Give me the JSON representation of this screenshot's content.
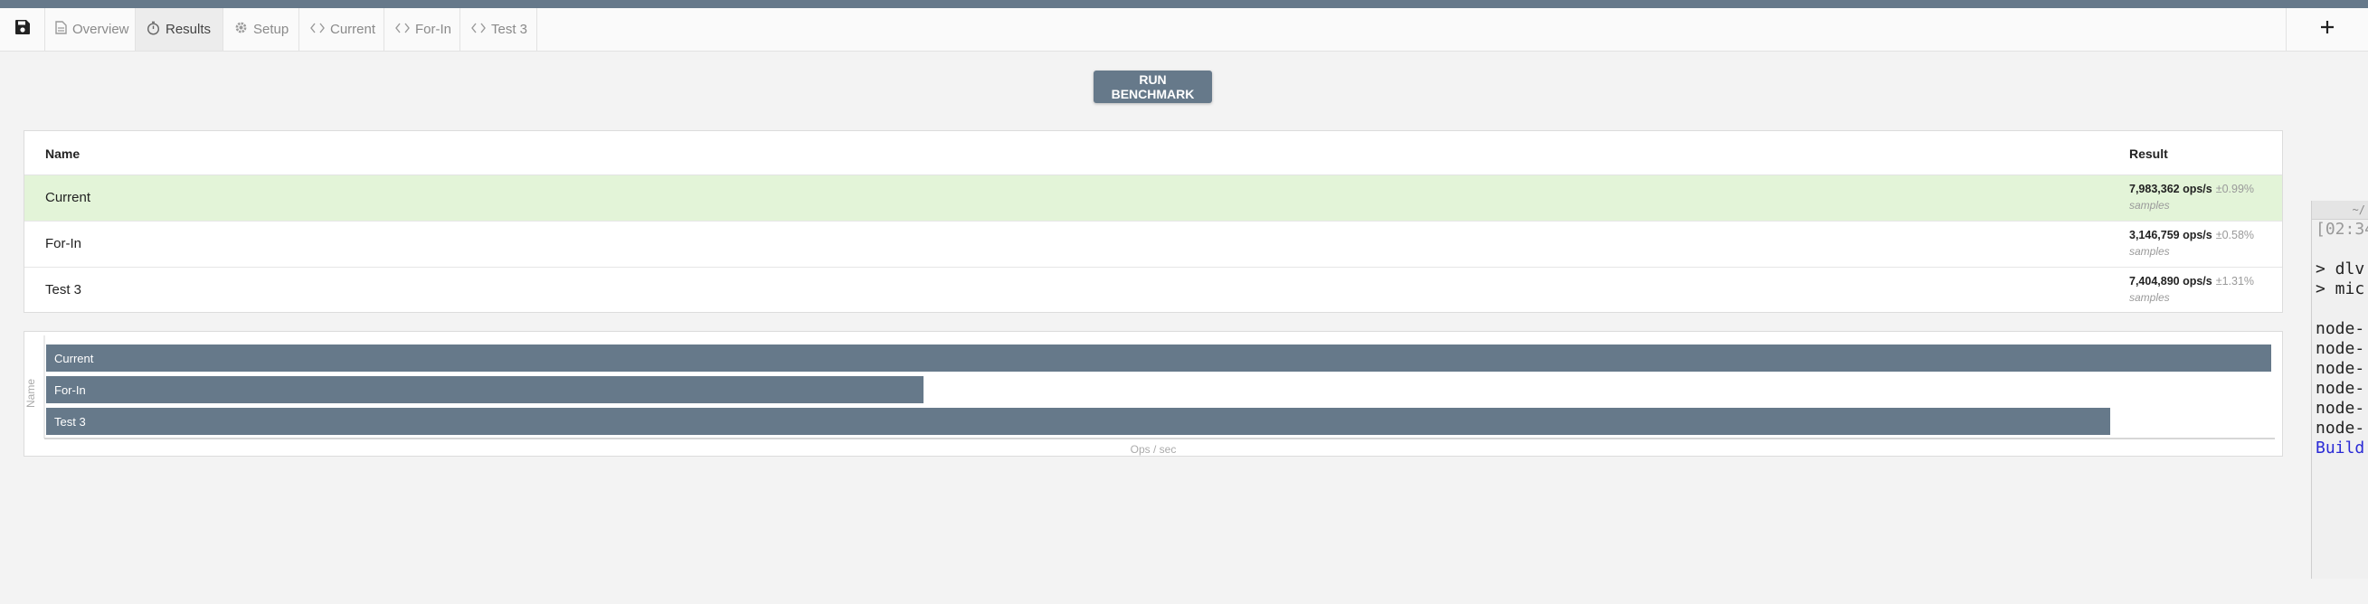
{
  "tabs": [
    {
      "label": "Overview",
      "icon": "document-icon",
      "active": false
    },
    {
      "label": "Results",
      "icon": "stopwatch-icon",
      "active": true
    },
    {
      "label": "Setup",
      "icon": "gear-icon",
      "active": false
    },
    {
      "label": "Current",
      "icon": "code-icon",
      "active": false
    },
    {
      "label": "For-In",
      "icon": "code-icon",
      "active": false
    },
    {
      "label": "Test 3",
      "icon": "code-icon",
      "active": false
    }
  ],
  "toolbar": {
    "save_icon": "save-icon",
    "add_icon": "plus-icon"
  },
  "run_button": "RUN BENCHMARK",
  "results": {
    "col_name": "Name",
    "col_result": "Result",
    "rows": [
      {
        "name": "Current",
        "ops": "7,983,362 ops/s",
        "err": "±0.99%",
        "samples": "samples",
        "fastest": true
      },
      {
        "name": "For-In",
        "ops": "3,146,759 ops/s",
        "err": "±0.58%",
        "samples": "samples",
        "fastest": false
      },
      {
        "name": "Test 3",
        "ops": "7,404,890 ops/s",
        "err": "±1.31%",
        "samples": "samples",
        "fastest": false
      }
    ]
  },
  "chart_data": {
    "type": "bar",
    "orientation": "horizontal",
    "categories": [
      "Current",
      "For-In",
      "Test 3"
    ],
    "values": [
      7983362,
      3146759,
      7404890
    ],
    "xlabel": "Ops / sec",
    "ylabel": "Name",
    "bar_color": "#66798a",
    "xlim": [
      0,
      7983362
    ]
  },
  "terminal": {
    "title": "~/",
    "lines": [
      {
        "text": "[02:34",
        "style": "dim"
      },
      {
        "text": "",
        "style": ""
      },
      {
        "text": "> dlv",
        "style": ""
      },
      {
        "text": "> mic",
        "style": ""
      },
      {
        "text": "",
        "style": ""
      },
      {
        "text": "node-",
        "style": ""
      },
      {
        "text": "node-",
        "style": ""
      },
      {
        "text": "node-",
        "style": ""
      },
      {
        "text": "node-",
        "style": ""
      },
      {
        "text": "node-",
        "style": ""
      },
      {
        "text": "node-",
        "style": ""
      },
      {
        "text": "Build",
        "style": "blue"
      }
    ]
  },
  "colors": {
    "accent": "#66798a",
    "fastest_row": "#e3f4d8"
  }
}
